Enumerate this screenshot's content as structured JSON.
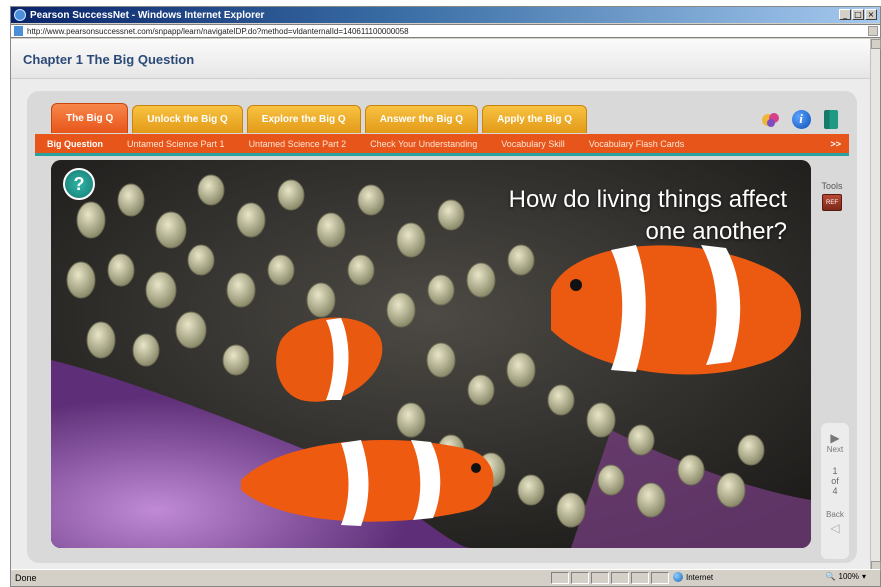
{
  "window": {
    "title": "Pearson SuccessNet - Windows Internet Explorer",
    "url": "http://www.pearsonsuccessnet.com/snpapp/learn/navigateIDP.do?method=vldanternalId=140611100000058"
  },
  "chapter": {
    "title": "Chapter 1  The Big Question"
  },
  "tabs": [
    {
      "label": "The Big Q",
      "active": true
    },
    {
      "label": "Unlock the Big Q",
      "active": false
    },
    {
      "label": "Explore the Big Q",
      "active": false
    },
    {
      "label": "Answer the Big Q",
      "active": false
    },
    {
      "label": "Apply the Big Q",
      "active": false
    }
  ],
  "header_icons": [
    "tools-people-icon",
    "info-icon",
    "book-icon"
  ],
  "subnav": {
    "items": [
      {
        "label": "Big Question",
        "active": true
      },
      {
        "label": "Untamed Science Part 1",
        "active": false
      },
      {
        "label": "Untamed Science Part 2",
        "active": false
      },
      {
        "label": "Check Your Understanding",
        "active": false
      },
      {
        "label": "Vocabulary Skill",
        "active": false
      },
      {
        "label": "Vocabulary Flash Cards",
        "active": false
      }
    ],
    "more": ">>"
  },
  "stage": {
    "question_line1": "How do living things affect",
    "question_line2": "one another?",
    "help_icon": "?"
  },
  "tools": {
    "label": "Tools",
    "button_text": "REF"
  },
  "pager": {
    "next": "Next",
    "current": "1",
    "of": "of",
    "total": "4",
    "back": "Back"
  },
  "statusbar": {
    "left": "Done",
    "zone": "Internet",
    "zoom": "100%"
  },
  "colors": {
    "tab_active": "#e8551a",
    "tab_inactive": "#f0a826",
    "subnav": "#e8551a",
    "accent_teal": "#2aa3a0",
    "chapter_text": "#2c4a78"
  }
}
